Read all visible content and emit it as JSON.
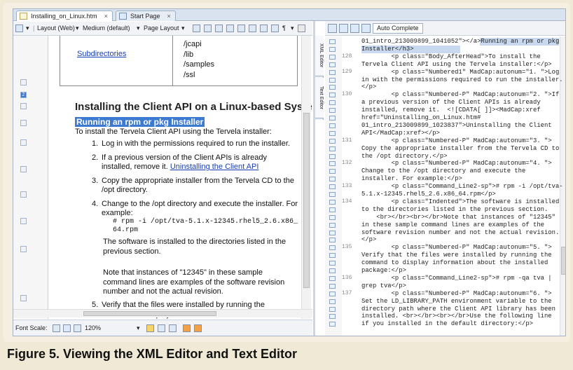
{
  "tabs": [
    {
      "label": "Installing_on_Linux.htm",
      "close": "×"
    },
    {
      "label": "Start Page",
      "close": "×"
    }
  ],
  "toolbar": {
    "layout": "Layout (Web)",
    "medium": "Medium (default)",
    "page_layout": "Page Layout"
  },
  "vtabs": [
    "XML Editor",
    "Text Editor"
  ],
  "doc": {
    "table": {
      "col1": "Subdirectories",
      "col2": [
        "/jcapi",
        "/lib",
        "/samples",
        "/ssl"
      ]
    },
    "heading": "Installing the Client API on a Linux-based System",
    "subheading": "Running an rpm or pkg Installer",
    "intro": "To install the Tervela Client API using the Tervela installer:",
    "steps": [
      {
        "num": "1.",
        "text": "Log in with the permissions required to run the installer."
      },
      {
        "num": "2.",
        "text": "If a previous version of the Client APIs is already installed, remove it.",
        "link": "Uninstalling the Client API"
      },
      {
        "num": "3.",
        "text": "Copy the appropriate installer from the Tervela CD to the /opt directory."
      },
      {
        "num": "4.",
        "text": "Change to the /opt directory and execute the installer. For example:"
      }
    ],
    "command": [
      "# rpm -i /opt/tva-5.1.x-12345.rhel5_2.6.x86_",
      "64.rpm"
    ],
    "para1": "The software is installed to the directories listed in the previous section.",
    "para2": "Note that instances of \"12345\" in these sample command lines are examples of the software revision number and not the actual revision.",
    "step5": {
      "num": "5.",
      "text": "Verify that the files were installed by running the command to display information about the installed package:"
    }
  },
  "status": {
    "font_scale_label": "Font Scale:",
    "zoom": "120%"
  },
  "right": {
    "auto_complete": "Auto Complete"
  },
  "code_lines": [
    {
      "n": "",
      "t": "01_intro_213009899_1041052\"></a>Running an rpm or pkg"
    },
    {
      "n": "",
      "t": "Installer</h3>"
    },
    {
      "n": "128",
      "t": "        <p class=\"Body_AfterHead\">To install the"
    },
    {
      "n": "",
      "t": "Tervela Client API using the Tervela installer:</p>"
    },
    {
      "n": "129",
      "t": "        <p class=\"Numbered1\" MadCap:autonum=\"1. \">Log"
    },
    {
      "n": "",
      "t": "in with the permissions required to run the installer."
    },
    {
      "n": "",
      "t": "</p>"
    },
    {
      "n": "130",
      "t": "        <p class=\"Numbered-P\" MadCap:autonum=\"2. \">If"
    },
    {
      "n": "",
      "t": "a previous version of the Client APIs is already"
    },
    {
      "n": "",
      "t": "installed, remove it.  <![CDATA[ ]]><MadCap:xref"
    },
    {
      "n": "",
      "t": "href=\"Uninstalling_on_Linux.htm#"
    },
    {
      "n": "",
      "t": "01_intro_213009899_1023837\">Uninstalling the Client"
    },
    {
      "n": "",
      "t": "API</MadCap:xref></p>"
    },
    {
      "n": "131",
      "t": "        <p class=\"Numbered-P\" MadCap:autonum=\"3. \">"
    },
    {
      "n": "",
      "t": "Copy the appropriate installer from the Tervela CD to"
    },
    {
      "n": "",
      "t": "the /opt directory.</p>"
    },
    {
      "n": "132",
      "t": "        <p class=\"Numbered-P\" MadCap:autonum=\"4. \">"
    },
    {
      "n": "",
      "t": "Change to the /opt directory and execute the"
    },
    {
      "n": "",
      "t": "installer. For example:</p>"
    },
    {
      "n": "133",
      "t": "        <p class=\"Command_Line2-sp\"># rpm -i /opt/tva-"
    },
    {
      "n": "",
      "t": "5.1.x-12345.rhel5_2.6.x86_64.rpm</p>"
    },
    {
      "n": "134",
      "t": "        <p class=\"Indented\">The software is installed"
    },
    {
      "n": "",
      "t": "to the directories listed in the previous section."
    },
    {
      "n": "",
      "t": "    <br></br><br></br>Note that instances of \"12345\""
    },
    {
      "n": "",
      "t": "in these sample command lines are examples of the"
    },
    {
      "n": "",
      "t": "software revision number and not the actual revision."
    },
    {
      "n": "",
      "t": "</p>"
    },
    {
      "n": "135",
      "t": "        <p class=\"Numbered-P\" MadCap:autonum=\"5. \">"
    },
    {
      "n": "",
      "t": "Verify that the files were installed by running the"
    },
    {
      "n": "",
      "t": "command to display information about the installed"
    },
    {
      "n": "",
      "t": "package:</p>"
    },
    {
      "n": "136",
      "t": "        <p class=\"Command_Line2-sp\"># rpm -qa tva |"
    },
    {
      "n": "",
      "t": "grep tva</p>"
    },
    {
      "n": "137",
      "t": "        <p class=\"Numbered-P\" MadCap:autonum=\"6. \">"
    },
    {
      "n": "",
      "t": "Set the LD_LIBRARY_PATH environment variable to the"
    },
    {
      "n": "",
      "t": "directory path where the Client API library has been"
    },
    {
      "n": "",
      "t": "installed. <br></br><br></br>Use the following line"
    },
    {
      "n": "",
      "t": "if you installed in the default directory:</p>"
    }
  ],
  "caption": "Figure 5. Viewing the XML Editor and Text Editor"
}
